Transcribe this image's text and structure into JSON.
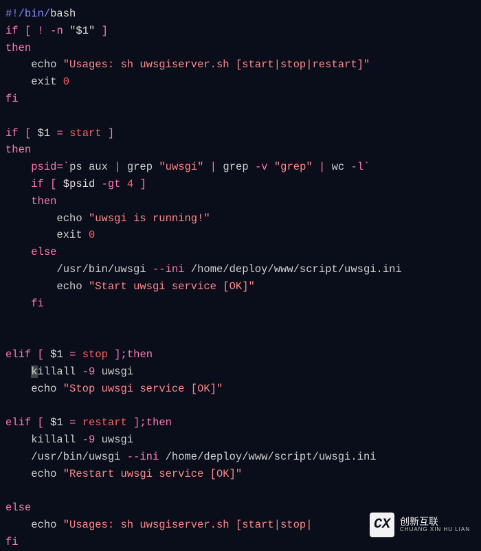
{
  "code": {
    "line1_shebang_prefix": "#!/bin/",
    "line1_shebang_bash": "bash",
    "if_kw": "if",
    "then_kw": "then",
    "elif_kw": "elif",
    "else_kw": "else",
    "fi_kw": "fi",
    "echo_kw": "echo",
    "exit_kw": "exit",
    "lbracket": "[",
    "rbracket": "]",
    "not": "!",
    "n_flag": "-n",
    "gt_flag": "-gt",
    "v_flag": "-v",
    "l_flag": "-l",
    "nine_flag": "-9",
    "ini_flag": "--ini",
    "eq": "=",
    "semicolon": ";",
    "pipe": "|",
    "backtick": "`",
    "dollar1": "$1",
    "dollar1_quoted": "\"$1\"",
    "psid_assign": "psid",
    "psid_ref": "$psid",
    "ps_cmd": "ps",
    "aux": "aux",
    "grep": "grep",
    "wc": "wc",
    "killall_k": "k",
    "killall_rest": "illall",
    "killall": "killall",
    "uwsgi_txt": "uwsgi",
    "start_txt": "start",
    "stop_txt": "stop",
    "restart_txt": "restart",
    "four": "4",
    "zero": "0",
    "usages_str": "\"Usages: sh uwsgiserver.sh [start|stop|restart]\"",
    "usages_str2": "\"Usages: sh uwsgiserver.sh [start|stop|",
    "uwsgi_str": "\"uwsgi\"",
    "grep_str": "\"grep\"",
    "running_str": "\"uwsgi is running!\"",
    "start_ok_str": "\"Start uwsgi service [OK]\"",
    "stop_ok_str": "\"Stop uwsgi service [OK]\"",
    "restart_ok_str": "\"Restart uwsgi service [OK]\"",
    "uwsgi_bin": "/usr/bin/uwsgi",
    "ini_path": "/home/deploy/www/script/uwsgi.ini"
  },
  "watermark": {
    "logo": "CX",
    "title": "创新互联",
    "subtitle": "CHUANG XIN HU LIAN"
  }
}
